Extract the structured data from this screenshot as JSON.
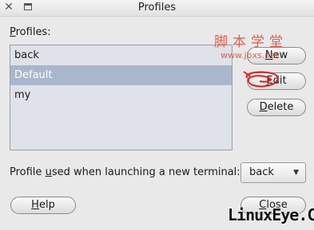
{
  "window": {
    "title": "Profiles"
  },
  "profiles_label": {
    "first": "P",
    "rest": "rofiles:"
  },
  "profiles": [
    {
      "name": "back",
      "selected": false
    },
    {
      "name": "Default",
      "selected": true
    },
    {
      "name": "my",
      "selected": false
    }
  ],
  "buttons": {
    "new_mnemonic": "N",
    "new_rest": "ew",
    "edit_mnemonic": "E",
    "edit_rest": "dit",
    "delete_mnemonic": "D",
    "delete_rest": "elete",
    "help_mnemonic": "H",
    "help_rest": "elp",
    "close_mnemonic": "C",
    "close_rest": "lose"
  },
  "launch": {
    "label_pre": "Profile ",
    "label_mnemonic": "u",
    "label_post": "sed when launching a new terminal:",
    "selected": "back"
  },
  "watermark": {
    "chinese": "脚本学堂",
    "url": "www.jbxs.net",
    "logo": "LinuxEye.CN"
  },
  "colors": {
    "selection": "#a9b7cc",
    "list_bg": "#dfe2e8",
    "watermark": "#e2452f"
  }
}
